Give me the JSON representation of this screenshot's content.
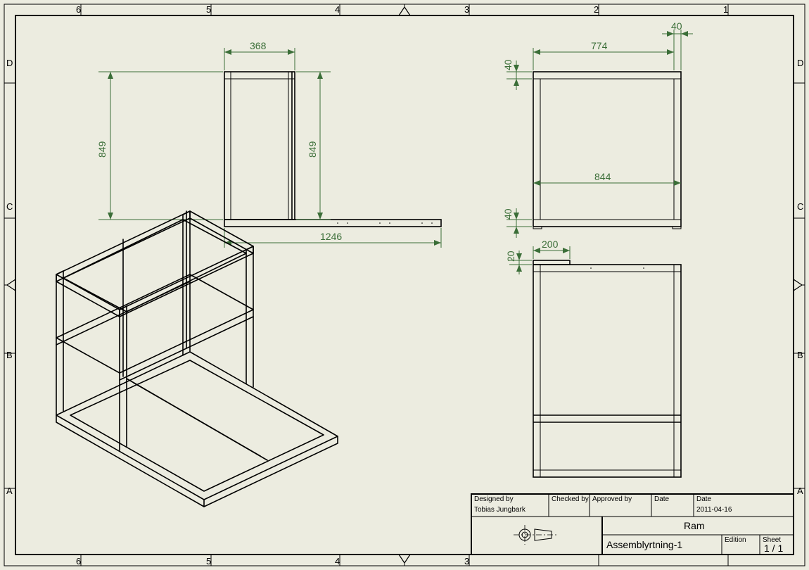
{
  "ruler": {
    "letters": [
      "D",
      "C",
      "B",
      "A"
    ],
    "numbers": [
      "6",
      "5",
      "4",
      "3",
      "2",
      "1"
    ]
  },
  "dims": {
    "front_top": "368",
    "front_left": "849",
    "front_right": "849",
    "front_bottom": "1246",
    "right_top": "774",
    "right_top_small": "40",
    "right_left_small_top": "40",
    "right_left_small_bot": "40",
    "right_inner": "844",
    "top_small_w": "200",
    "top_small_h": "20"
  },
  "title_block": {
    "designed_by_label": "Designed by",
    "designed_by": "Tobias Jungbark",
    "checked_by_label": "Checked by",
    "approved_by_label": "Approved by",
    "date_label1": "Date",
    "date_label2": "Date",
    "date": "2011-04-16",
    "title": "Ram",
    "drawing": "Assemblyrtning-1",
    "edition_label": "Edition",
    "sheet_label": "Sheet",
    "sheet": "1 / 1"
  }
}
